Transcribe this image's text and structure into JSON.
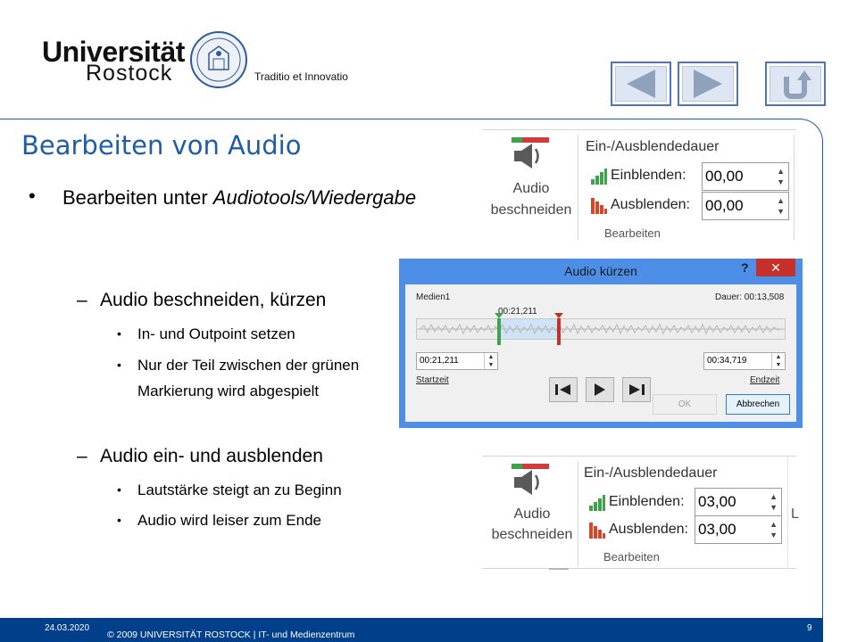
{
  "header": {
    "logo_title": "Universität",
    "logo_sub": "Rostock",
    "motto": "Traditio et Innovatio"
  },
  "nav": {
    "icons": [
      "previous-arrow-icon",
      "next-arrow-icon",
      "return-icon"
    ]
  },
  "slide": {
    "title": "Bearbeiten von Audio",
    "bullet1_prefix": "Bearbeiten unter ",
    "bullet1_italic": "Audiotools/Wiedergabe",
    "sub1": "Audio beschneiden, kürzen",
    "sub1_items": [
      "In- und Outpoint setzen",
      "Nur der Teil zwischen der grünen",
      "Markierung wird abgespielt"
    ],
    "sub2": "Audio ein- und ausblenden",
    "sub2_items": [
      "Lautstärke steigt an zu Beginn",
      "Audio wird leiser zum Ende"
    ]
  },
  "ribbon_top": {
    "button_label_1": "Audio",
    "button_label_2": "beschneiden",
    "header": "Ein-/Ausblendedauer",
    "fade_in_label": "Einblenden:",
    "fade_in_value": "00,00",
    "fade_out_label": "Ausblenden:",
    "fade_out_value": "00,00",
    "group_label": "Bearbeiten"
  },
  "ribbon_bottom": {
    "button_label_1": "Audio",
    "button_label_2": "beschneiden",
    "header": "Ein-/Ausblendedauer",
    "fade_in_label": "Einblenden:",
    "fade_in_value": "03,00",
    "fade_out_label": "Ausblenden:",
    "fade_out_value": "03,00",
    "group_label": "Bearbeiten",
    "edge_glyph": "L"
  },
  "dialog": {
    "title": "Audio kürzen",
    "help": "?",
    "close": "✕",
    "media_name": "Medien1",
    "duration": "Dauer: 00:13,508",
    "marker_time": "00:21,211",
    "start_value": "00:21,211",
    "start_label": "Startzeit",
    "end_value": "00:34,719",
    "end_label": "Endzeit",
    "ok_label": "OK",
    "cancel_label": "Abbrechen"
  },
  "footer": {
    "date": "24.03.2020",
    "copyright": "© 2009  UNIVERSITÄT ROSTOCK  |  IT- und Medienzentrum",
    "page": "9"
  },
  "colors": {
    "accent": "#1f5da8",
    "footer_bg": "#003f8a",
    "dialog_frame": "#4d8ee6",
    "close_red": "#c5302a",
    "fade_in_green": "#3fa34d",
    "fade_out_red": "#d0492d"
  }
}
